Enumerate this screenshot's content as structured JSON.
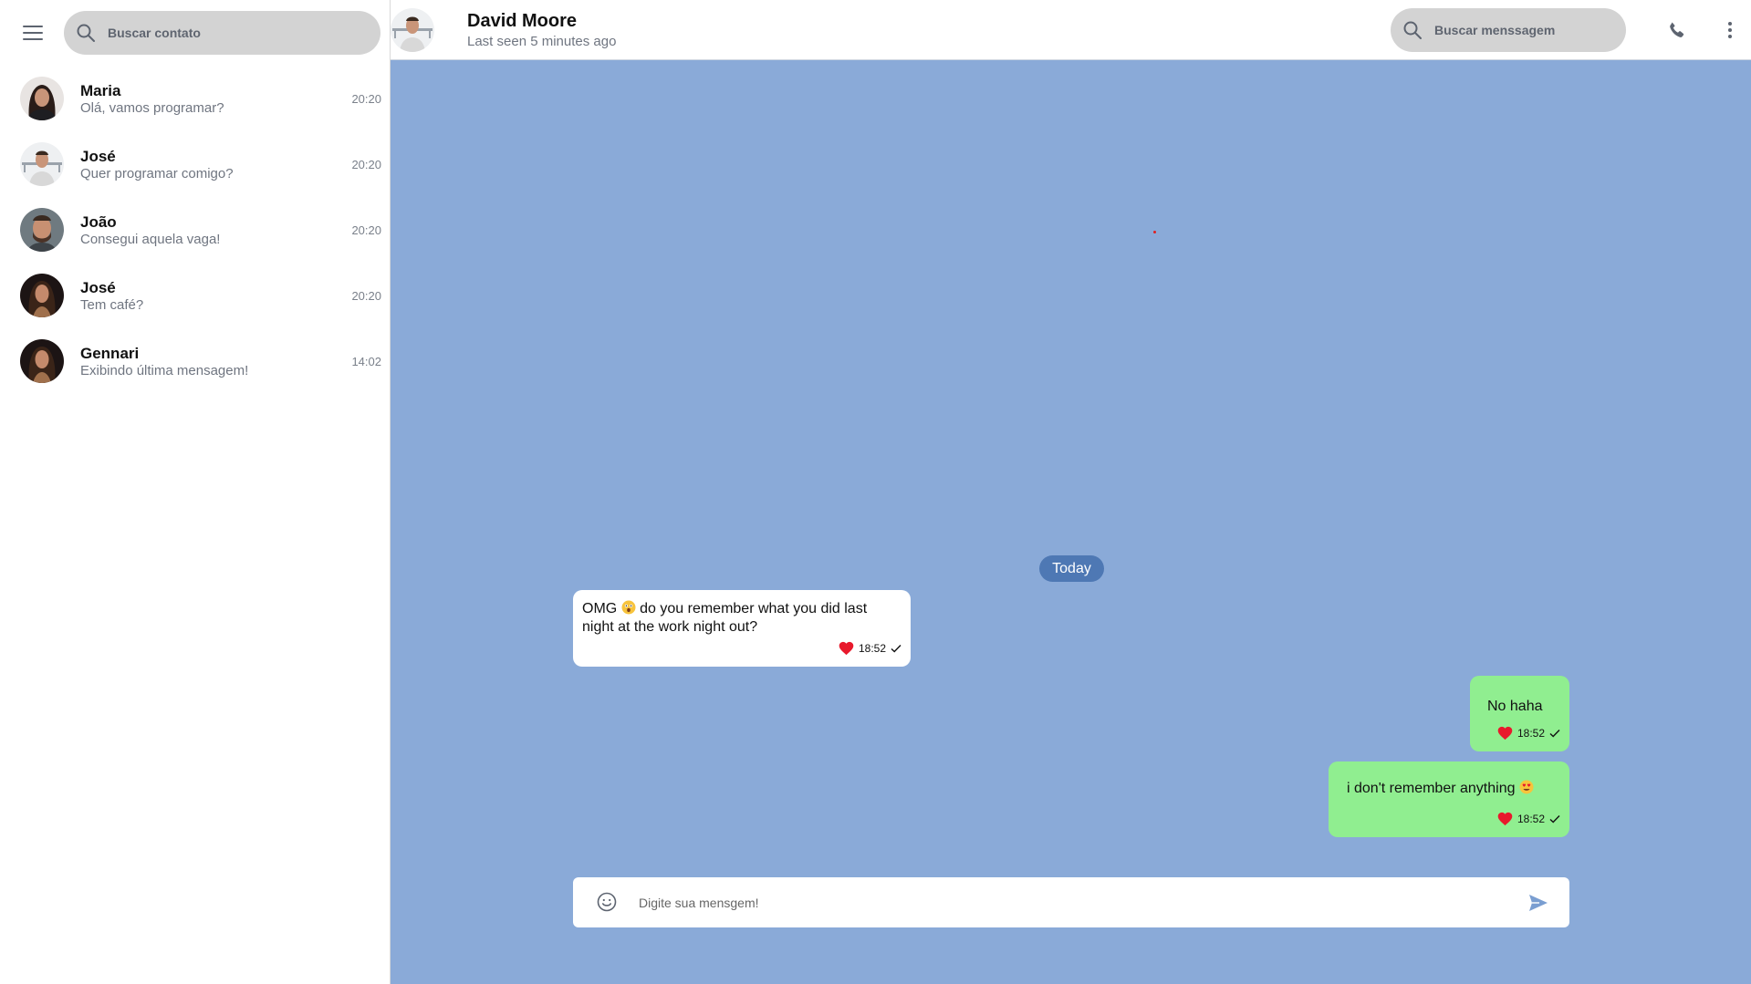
{
  "sidebar": {
    "search": {
      "placeholder": "Buscar contato",
      "icon": "search-icon"
    },
    "menu_icon": "hamburger-menu-icon",
    "contacts": [
      {
        "name": "Maria",
        "last_message": "Olá, vamos programar?",
        "time": "20:20"
      },
      {
        "name": "José",
        "last_message": "Quer programar comigo?",
        "time": "20:20"
      },
      {
        "name": "João",
        "last_message": "Consegui aquela vaga!",
        "time": "20:20"
      },
      {
        "name": "José",
        "last_message": "Tem café?",
        "time": "20:20"
      },
      {
        "name": "Gennari",
        "last_message": "Exibindo última mensagem!",
        "time": "14:02"
      }
    ]
  },
  "header": {
    "name": "David Moore",
    "status": "Last seen 5 minutes ago",
    "search": {
      "placeholder": "Buscar menssagem"
    },
    "phone_icon": "phone-icon",
    "more_icon": "more-vertical-icon"
  },
  "chat": {
    "date_label": "Today",
    "messages": [
      {
        "direction": "incoming",
        "text_before": "OMG",
        "emoji": "astonished-emoji",
        "text_after": "do you remember what you did last night at the work night out?",
        "time": "18:52",
        "reaction": "heart"
      },
      {
        "direction": "outgoing",
        "text": "No haha",
        "time": "18:52",
        "reaction": "heart"
      },
      {
        "direction": "outgoing",
        "text": "i don't remember anything",
        "emoji": "heart-eyes-emoji",
        "time": "18:52",
        "reaction": "heart"
      }
    ]
  },
  "composer": {
    "placeholder": "Digite sua mensgem!",
    "emoji_icon": "smiley-icon",
    "send_icon": "send-icon"
  },
  "colors": {
    "chat_background": "#8aaad8",
    "outgoing_bubble": "#90ee90",
    "incoming_bubble": "#ffffff",
    "date_pill": "#4e78b4",
    "search_background": "#d3d3d3"
  }
}
